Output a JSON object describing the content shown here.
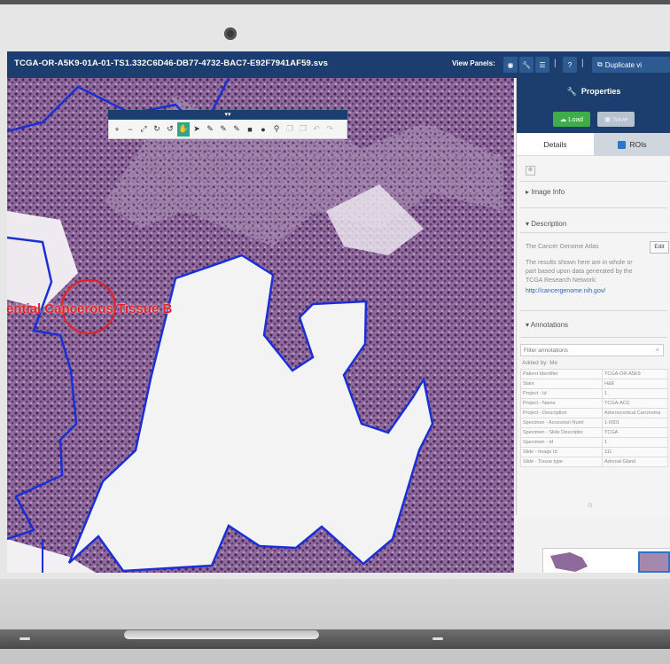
{
  "app": {
    "file_title": "TCGA-OR-A5K9-01A-01-TS1.332C6D46-DB77-4732-BAC7-E92F7941AF59.svs"
  },
  "topbar": {
    "view_panels_label": "View Panels:",
    "separator": "|",
    "help_label": "?",
    "duplicate_label": "Duplicate vi"
  },
  "toolbar": {
    "collapse_glyph": "▾▾",
    "tools": [
      {
        "icon": "zoom-in-icon",
        "glyph": "+"
      },
      {
        "icon": "zoom-out-icon",
        "glyph": "−"
      },
      {
        "icon": "fullscreen-icon",
        "glyph": "⤢"
      },
      {
        "icon": "rotate-right-icon",
        "glyph": "↻"
      },
      {
        "icon": "rotate-left-icon",
        "glyph": "↺"
      },
      {
        "icon": "pan-hand-icon",
        "glyph": "✋"
      },
      {
        "icon": "pointer-icon",
        "glyph": "➤"
      },
      {
        "icon": "pencil-icon",
        "glyph": "✎"
      },
      {
        "icon": "pencil-alt-icon",
        "glyph": "✎"
      },
      {
        "icon": "freehand-icon",
        "glyph": "✎"
      },
      {
        "icon": "rectangle-icon",
        "glyph": "■"
      },
      {
        "icon": "circle-icon",
        "glyph": "●"
      },
      {
        "icon": "pin-icon",
        "glyph": "⚲"
      },
      {
        "icon": "copy-icon",
        "glyph": "❐"
      },
      {
        "icon": "paste-icon",
        "glyph": "❐"
      },
      {
        "icon": "undo-icon",
        "glyph": "↶"
      },
      {
        "icon": "redo-icon",
        "glyph": "↷"
      }
    ]
  },
  "viewer": {
    "annotation_label": "tential Cancerous Tissue B",
    "annotation_color": "#e0252a",
    "roi_color": "#1a2fd6"
  },
  "panel": {
    "header": "Properties",
    "load_label": "Load",
    "save_label": "Save",
    "tabs": [
      "Details",
      "ROIs"
    ],
    "image_info": "Image Info",
    "description_title": "Description",
    "description_line1": "The Cancer Genome Atlas",
    "edit_label": "Edit",
    "description_text": "The results shown here are in whole or part based upon data generated by the TCGA Research Network:",
    "description_link": "http://cancergenome.nih.gov/",
    "annotations_title": "Annotations",
    "filter_placeholder": "Filter annotations",
    "added_by": "Added by: Me",
    "annotations": [
      [
        "Patient Identifier",
        "TCGA-OR-A5K9"
      ],
      [
        "Stain",
        "H&E"
      ],
      [
        "Project - Id",
        "1"
      ],
      [
        "Project - Name",
        "TCGA-ACC"
      ],
      [
        "Project - Description",
        "Adrenocortical Carcinoma"
      ],
      [
        "Specimen - Accession Numl",
        "1-0001"
      ],
      [
        "Specimen - Slide Descriptio",
        "TCGA"
      ],
      [
        "Specimen - Id",
        "1"
      ],
      [
        "Slide - Image Id",
        "111"
      ],
      [
        "Slide - Tissue type",
        "Adrenal Gland"
      ]
    ]
  },
  "colors": {
    "navbar": "#1b3e6e",
    "accent_green": "#3fae49",
    "tissue": "#6a3f7c"
  }
}
